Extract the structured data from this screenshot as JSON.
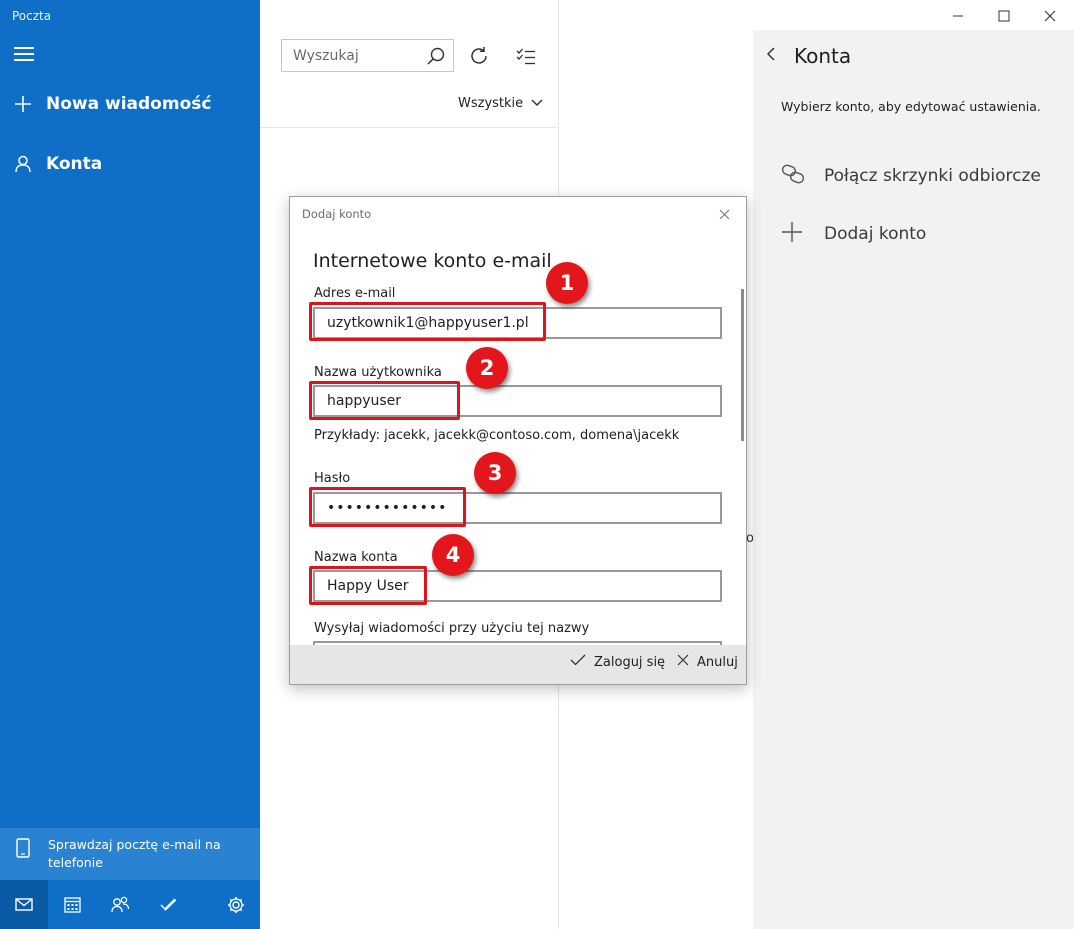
{
  "app": {
    "title": "Poczta"
  },
  "sidebar": {
    "new_message": "Nowa wiadomość",
    "accounts": "Konta",
    "mobile_promo": "Sprawdzaj pocztę e-mail na telefonie",
    "bottom_icons": [
      "mail-icon",
      "calendar-icon",
      "people-icon",
      "todo-icon",
      "settings-icon"
    ]
  },
  "list": {
    "search_placeholder": "Wyszukaj",
    "filter_label": "Wszystkie"
  },
  "reading_pane": {
    "fragment": "o"
  },
  "accounts_panel": {
    "title": "Konta",
    "description": "Wybierz konto, aby edytować ustawienia.",
    "link_inboxes": "Połącz skrzynki odbiorcze",
    "add_account": "Dodaj konto"
  },
  "dialog": {
    "caption": "Dodaj konto",
    "heading": "Internetowe konto e-mail",
    "fields": {
      "email": {
        "label": "Adres e-mail",
        "value": "uzytkownik1@happyuser1.pl"
      },
      "username": {
        "label": "Nazwa użytkownika",
        "value": "happyuser",
        "hint": "Przykłady: jacekk, jacekk@contoso.com, domena\\jacekk"
      },
      "password": {
        "label": "Hasło",
        "value": "•••••••••••••"
      },
      "account_name": {
        "label": "Nazwa konta",
        "value": "Happy User"
      },
      "send_as": {
        "label": "Wysyłaj wiadomości przy użyciu tej nazwy"
      }
    },
    "footer": {
      "sign_in": "Zaloguj się",
      "cancel": "Anuluj"
    }
  },
  "annotations": {
    "badges": [
      "1",
      "2",
      "3",
      "4"
    ],
    "color": "#e3171b"
  },
  "colors": {
    "sidebar_bg": "#0f6fc6",
    "accounts_panel_bg": "#f2f2f2",
    "dialog_footer_bg": "#e6e6e6"
  }
}
